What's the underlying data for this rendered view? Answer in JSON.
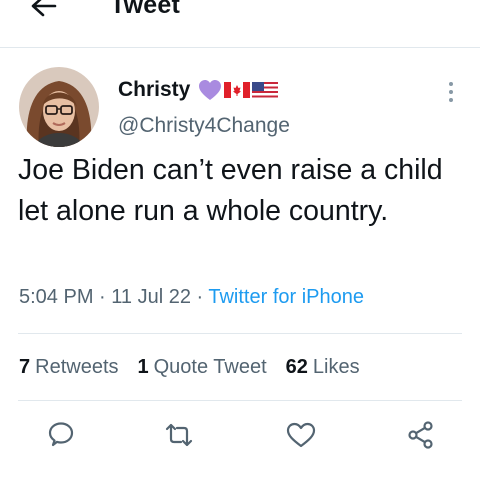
{
  "header": {
    "title": "Tweet",
    "back_icon": "arrow-left-icon"
  },
  "author": {
    "name": "Christy",
    "emojis": [
      "purple-heart",
      "canada-flag",
      "usa-flag"
    ],
    "handle": "@Christy4Change"
  },
  "tweet": {
    "text": "Joe Biden can’t even raise a child let alone run a whole country.",
    "time": "5:04 PM",
    "date": "11 Jul 22",
    "source": "Twitter for iPhone"
  },
  "stats": {
    "retweets_count": "7",
    "retweets_label": "Retweets",
    "quotes_count": "1",
    "quotes_label": "Quote Tweet",
    "likes_count": "62",
    "likes_label": "Likes"
  },
  "actions": [
    "reply-icon",
    "retweet-icon",
    "like-icon",
    "share-icon"
  ],
  "colors": {
    "link": "#1d9bf0",
    "muted": "#536471",
    "text": "#0f1419",
    "divider": "#e1e8ed"
  }
}
